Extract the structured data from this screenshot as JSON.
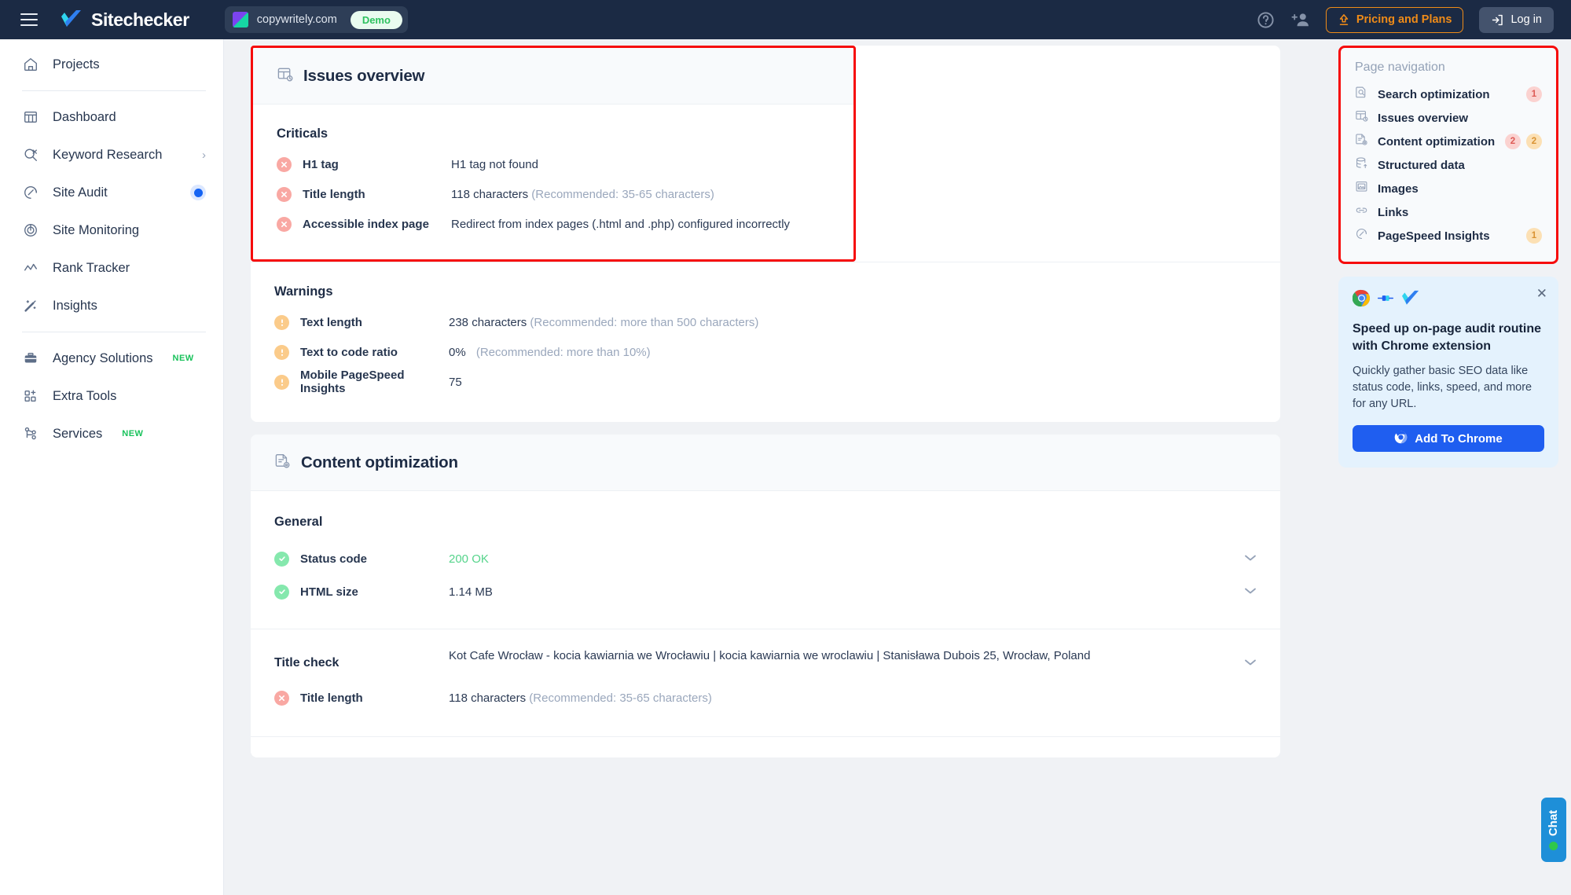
{
  "header": {
    "menu_icon": "hamburger-icon",
    "brand": "Sitechecker",
    "site_url": "copywritely.com",
    "demo_badge": "Demo",
    "help_icon": "question-circle-icon",
    "invite_icon": "add-user-icon",
    "pricing_label": "Pricing and Plans",
    "login_label": "Log in"
  },
  "sidebar": {
    "group1": [
      {
        "label": "Projects",
        "icon": "home-icon"
      }
    ],
    "group2": [
      {
        "label": "Dashboard",
        "icon": "dashboard-icon"
      },
      {
        "label": "Keyword Research",
        "icon": "keyword-search-icon",
        "chevron": "›"
      },
      {
        "label": "Site Audit",
        "icon": "gauge-icon",
        "active": true
      },
      {
        "label": "Site Monitoring",
        "icon": "radar-icon"
      },
      {
        "label": "Rank Tracker",
        "icon": "line-chart-icon"
      },
      {
        "label": "Insights",
        "icon": "magic-wand-icon"
      }
    ],
    "group3": [
      {
        "label": "Agency Solutions",
        "icon": "briefcase-icon",
        "tag": "NEW"
      },
      {
        "label": "Extra Tools",
        "icon": "grid-plus-icon"
      },
      {
        "label": "Services",
        "icon": "nodes-icon",
        "tag": "NEW"
      }
    ]
  },
  "issues_overview": {
    "title": "Issues overview",
    "icon": "issues-overview-icon",
    "criticals_heading": "Criticals",
    "criticals": [
      {
        "name": "H1 tag",
        "value": "H1 tag not found",
        "hint": "",
        "status": "error"
      },
      {
        "name": "Title length",
        "value": "118 characters",
        "hint": "(Recommended: 35-65 characters)",
        "status": "error"
      },
      {
        "name": "Accessible index page",
        "value": "Redirect from index pages (.html and .php) configured incorrectly",
        "hint": "",
        "status": "error"
      }
    ],
    "warnings_heading": "Warnings",
    "warnings": [
      {
        "name": "Text length",
        "value": "238 characters",
        "hint": "(Recommended: more than 500 characters)",
        "status": "warning"
      },
      {
        "name": "Text to code ratio",
        "value": "0%",
        "hint": "(Recommended: more than 10%)",
        "status": "warning"
      },
      {
        "name": "Mobile PageSpeed Insights",
        "value": "75",
        "hint": "",
        "status": "warning"
      }
    ]
  },
  "content_optimization": {
    "title": "Content optimization",
    "icon": "content-optimization-icon",
    "general_heading": "General",
    "general": [
      {
        "name": "Status code",
        "value": "200 OK",
        "status": "ok",
        "value_style": "ok"
      },
      {
        "name": "HTML size",
        "value": "1.14 MB",
        "status": "ok",
        "value_style": "plain"
      }
    ],
    "title_check": {
      "label": "Title check",
      "value": "Kot Cafe Wrocław - kocia kawiarnia we Wrocławiu | kocia kawiarnia we wroclawiu | Stanisława Dubois 25, Wrocław, Poland"
    },
    "title_length": {
      "name": "Title length",
      "value": "118 characters",
      "hint": "(Recommended: 35-65 characters)",
      "status": "error"
    }
  },
  "page_navigation": {
    "title": "Page navigation",
    "items": [
      {
        "label": "Search optimization",
        "icon": "search-doc-icon",
        "red": "1",
        "amber": ""
      },
      {
        "label": "Issues overview",
        "icon": "issues-overview-icon",
        "red": "",
        "amber": ""
      },
      {
        "label": "Content optimization",
        "icon": "content-optimization-icon",
        "red": "2",
        "amber": "2"
      },
      {
        "label": "Structured data",
        "icon": "database-icon",
        "red": "",
        "amber": ""
      },
      {
        "label": "Images",
        "icon": "image-icon",
        "red": "",
        "amber": ""
      },
      {
        "label": "Links",
        "icon": "link-icon",
        "red": "",
        "amber": ""
      },
      {
        "label": "PageSpeed Insights",
        "icon": "gauge-icon",
        "red": "",
        "amber": "1"
      }
    ]
  },
  "promo": {
    "close_icon": "close-icon",
    "chrome_icon": "chrome-icon",
    "plug_icon": "plug-icon",
    "sitechecker_icon": "sitechecker-check-icon",
    "title": "Speed up on-page audit routine with Chrome extension",
    "text": "Quickly gather basic SEO data like status code, links, speed, and more for any URL.",
    "button_label": "Add To Chrome"
  },
  "chat": {
    "label": "Chat"
  },
  "colors": {
    "header_bg": "#1b2a44",
    "accent_orange": "#ef8b18",
    "accent_blue": "#1f5ef0",
    "highlight_red": "#f60b0b",
    "error": "#f9a8a3",
    "warning": "#fbcb8a",
    "ok": "#85e8ad"
  }
}
